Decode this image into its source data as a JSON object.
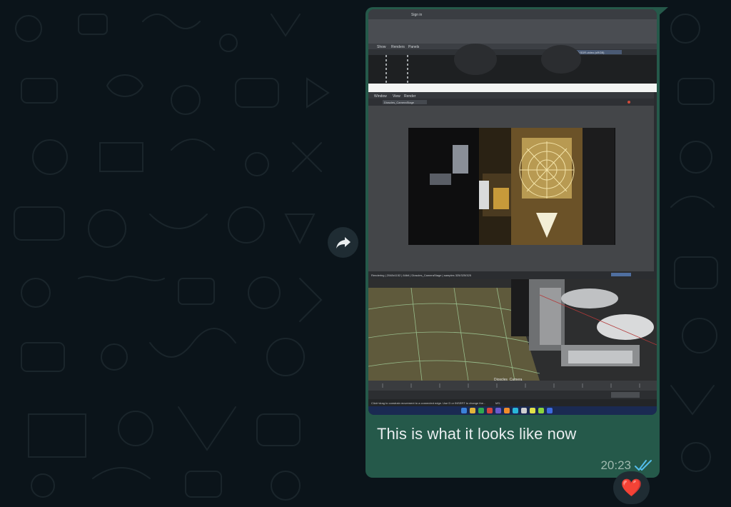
{
  "message": {
    "caption": "This is what it looks like now",
    "time": "20:23",
    "status_icon": "double-check-read-icon",
    "reaction": "❤️"
  },
  "photo_screen": {
    "menu_top": [
      "Show",
      "Renders",
      "Panels"
    ],
    "menu_render": [
      "Window",
      "View",
      "Render"
    ],
    "camera_select": "Dioscles_CameraStage",
    "sign_in": "Sign in",
    "status_line": "Rendering | 2048x1152 | 64bit | Dioscles_CameraStage | samples 325/325/325",
    "camera_label": "Dioscles_Camera",
    "bottom_hint": "Click+drag to constrain movement to a connected edge. Use D or INSERT to change the...",
    "bottom_field": "MS:",
    "ribbon_label": "ACES 1.0 SDR-video (sRGB)"
  },
  "colors": {
    "background": "#0b141a",
    "bubble": "#25594a",
    "read_ticks": "#53bdeb",
    "heart": "#e8283a"
  },
  "icons": {
    "forward": "forward-arrow-icon",
    "reaction": "heart-icon"
  }
}
